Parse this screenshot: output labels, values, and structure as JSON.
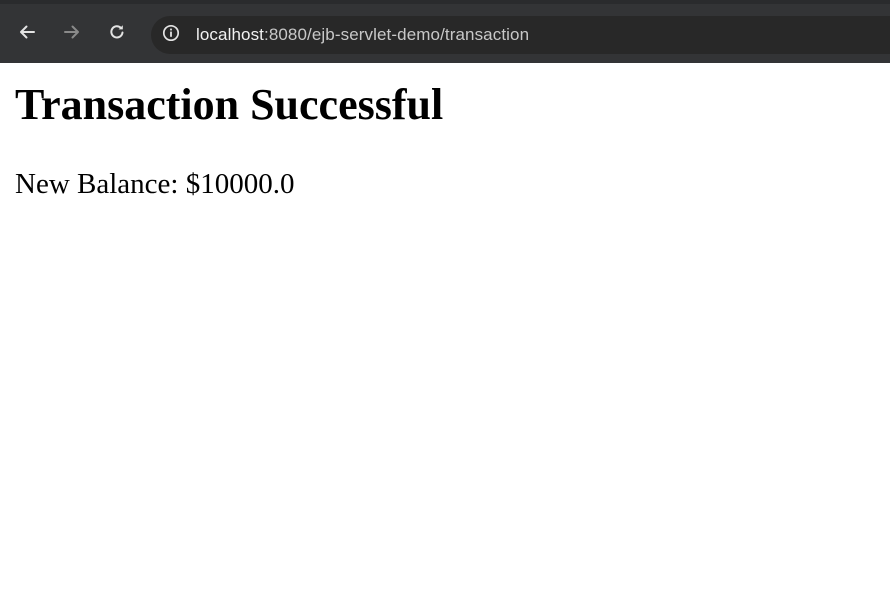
{
  "browser": {
    "url_host": "localhost",
    "url_rest": ":8080/ejb-servlet-demo/transaction",
    "icons": {
      "back": "arrow-left",
      "forward": "arrow-right",
      "reload": "reload",
      "site_info": "info-circle"
    },
    "colors": {
      "toolbar": "#333436",
      "omnibox": "#282828",
      "icon": "#e3e3e3",
      "icon_disabled": "#8a8a8a"
    }
  },
  "page": {
    "title": "Transaction Successful",
    "balance_label": "New Balance: ",
    "balance_value": "$10000.0"
  }
}
